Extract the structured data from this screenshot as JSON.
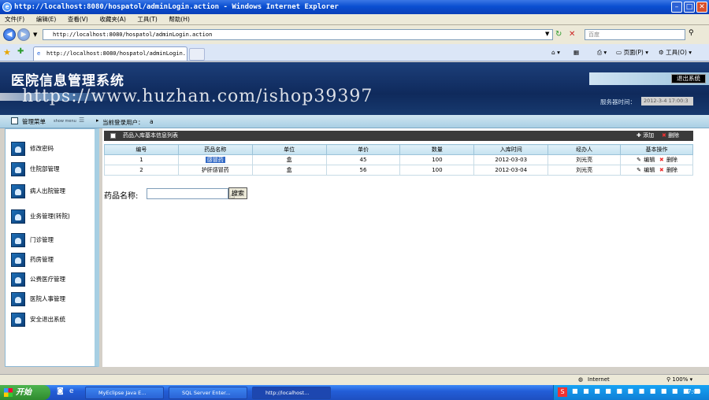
{
  "window": {
    "title": "http://localhost:8080/hospatol/adminLogin.action - Windows Internet Explorer"
  },
  "menu": [
    "文件(F)",
    "编辑(E)",
    "查看(V)",
    "收藏夹(A)",
    "工具(T)",
    "帮助(H)"
  ],
  "address": {
    "url": "http://localhost:8080/hospatol/adminLogin.action",
    "search_placeholder": "百度"
  },
  "tab": {
    "label": "http://localhost:8080/hospatol/adminLogin..."
  },
  "browser_toolbar": {
    "page": "页面(P)",
    "tools": "工具(O)"
  },
  "page": {
    "system_title": "医院信息管理系统",
    "exit_button": "退出系统",
    "watermark": "https://www.huzhan.com/ishop39397",
    "server_time_label": "服务器时间：",
    "server_time_value": "2012-3-4 17:00:3",
    "nav_menu_label": "管理菜单",
    "nav_menu_sub": "show menu",
    "current_user_label": "当前登录用户：",
    "current_user_value": "a"
  },
  "sidebar": {
    "items": [
      {
        "label": "修改密码"
      },
      {
        "label": "住院部管理"
      },
      {
        "label": "病人出院管理"
      },
      {
        "label": "业务管理(转院)"
      },
      {
        "label": "门诊管理"
      },
      {
        "label": "药房管理"
      },
      {
        "label": "公费医疗管理"
      },
      {
        "label": "医院人事管理"
      },
      {
        "label": "安全退出系统"
      }
    ]
  },
  "panel": {
    "title": "药品入库基本信息列表",
    "add": "添加",
    "delete": "删除"
  },
  "table": {
    "headers": [
      "编号",
      "药品名称",
      "单位",
      "单价",
      "数量",
      "入库时间",
      "经办人",
      "基本操作"
    ],
    "rows": [
      {
        "id": "1",
        "name": "感冒药",
        "unit": "盒",
        "price": "45",
        "qty": "100",
        "date": "2012-03-03",
        "handler": "刘光亮",
        "edit": "编辑",
        "del": "删除"
      },
      {
        "id": "2",
        "name": "护肝感冒药",
        "unit": "盒",
        "price": "56",
        "qty": "100",
        "date": "2012-03-04",
        "handler": "刘光亮",
        "edit": "编辑",
        "del": "删除"
      }
    ]
  },
  "search": {
    "label": "药品名称:",
    "button": "搜索"
  },
  "statusbar": {
    "zone": "Internet",
    "zoom": "100%"
  },
  "taskbar": {
    "start": "开始",
    "items": [
      "MyEclipse Java E...",
      "SQL Server Enter...",
      "http://localhost..."
    ],
    "clock": "17:00"
  }
}
